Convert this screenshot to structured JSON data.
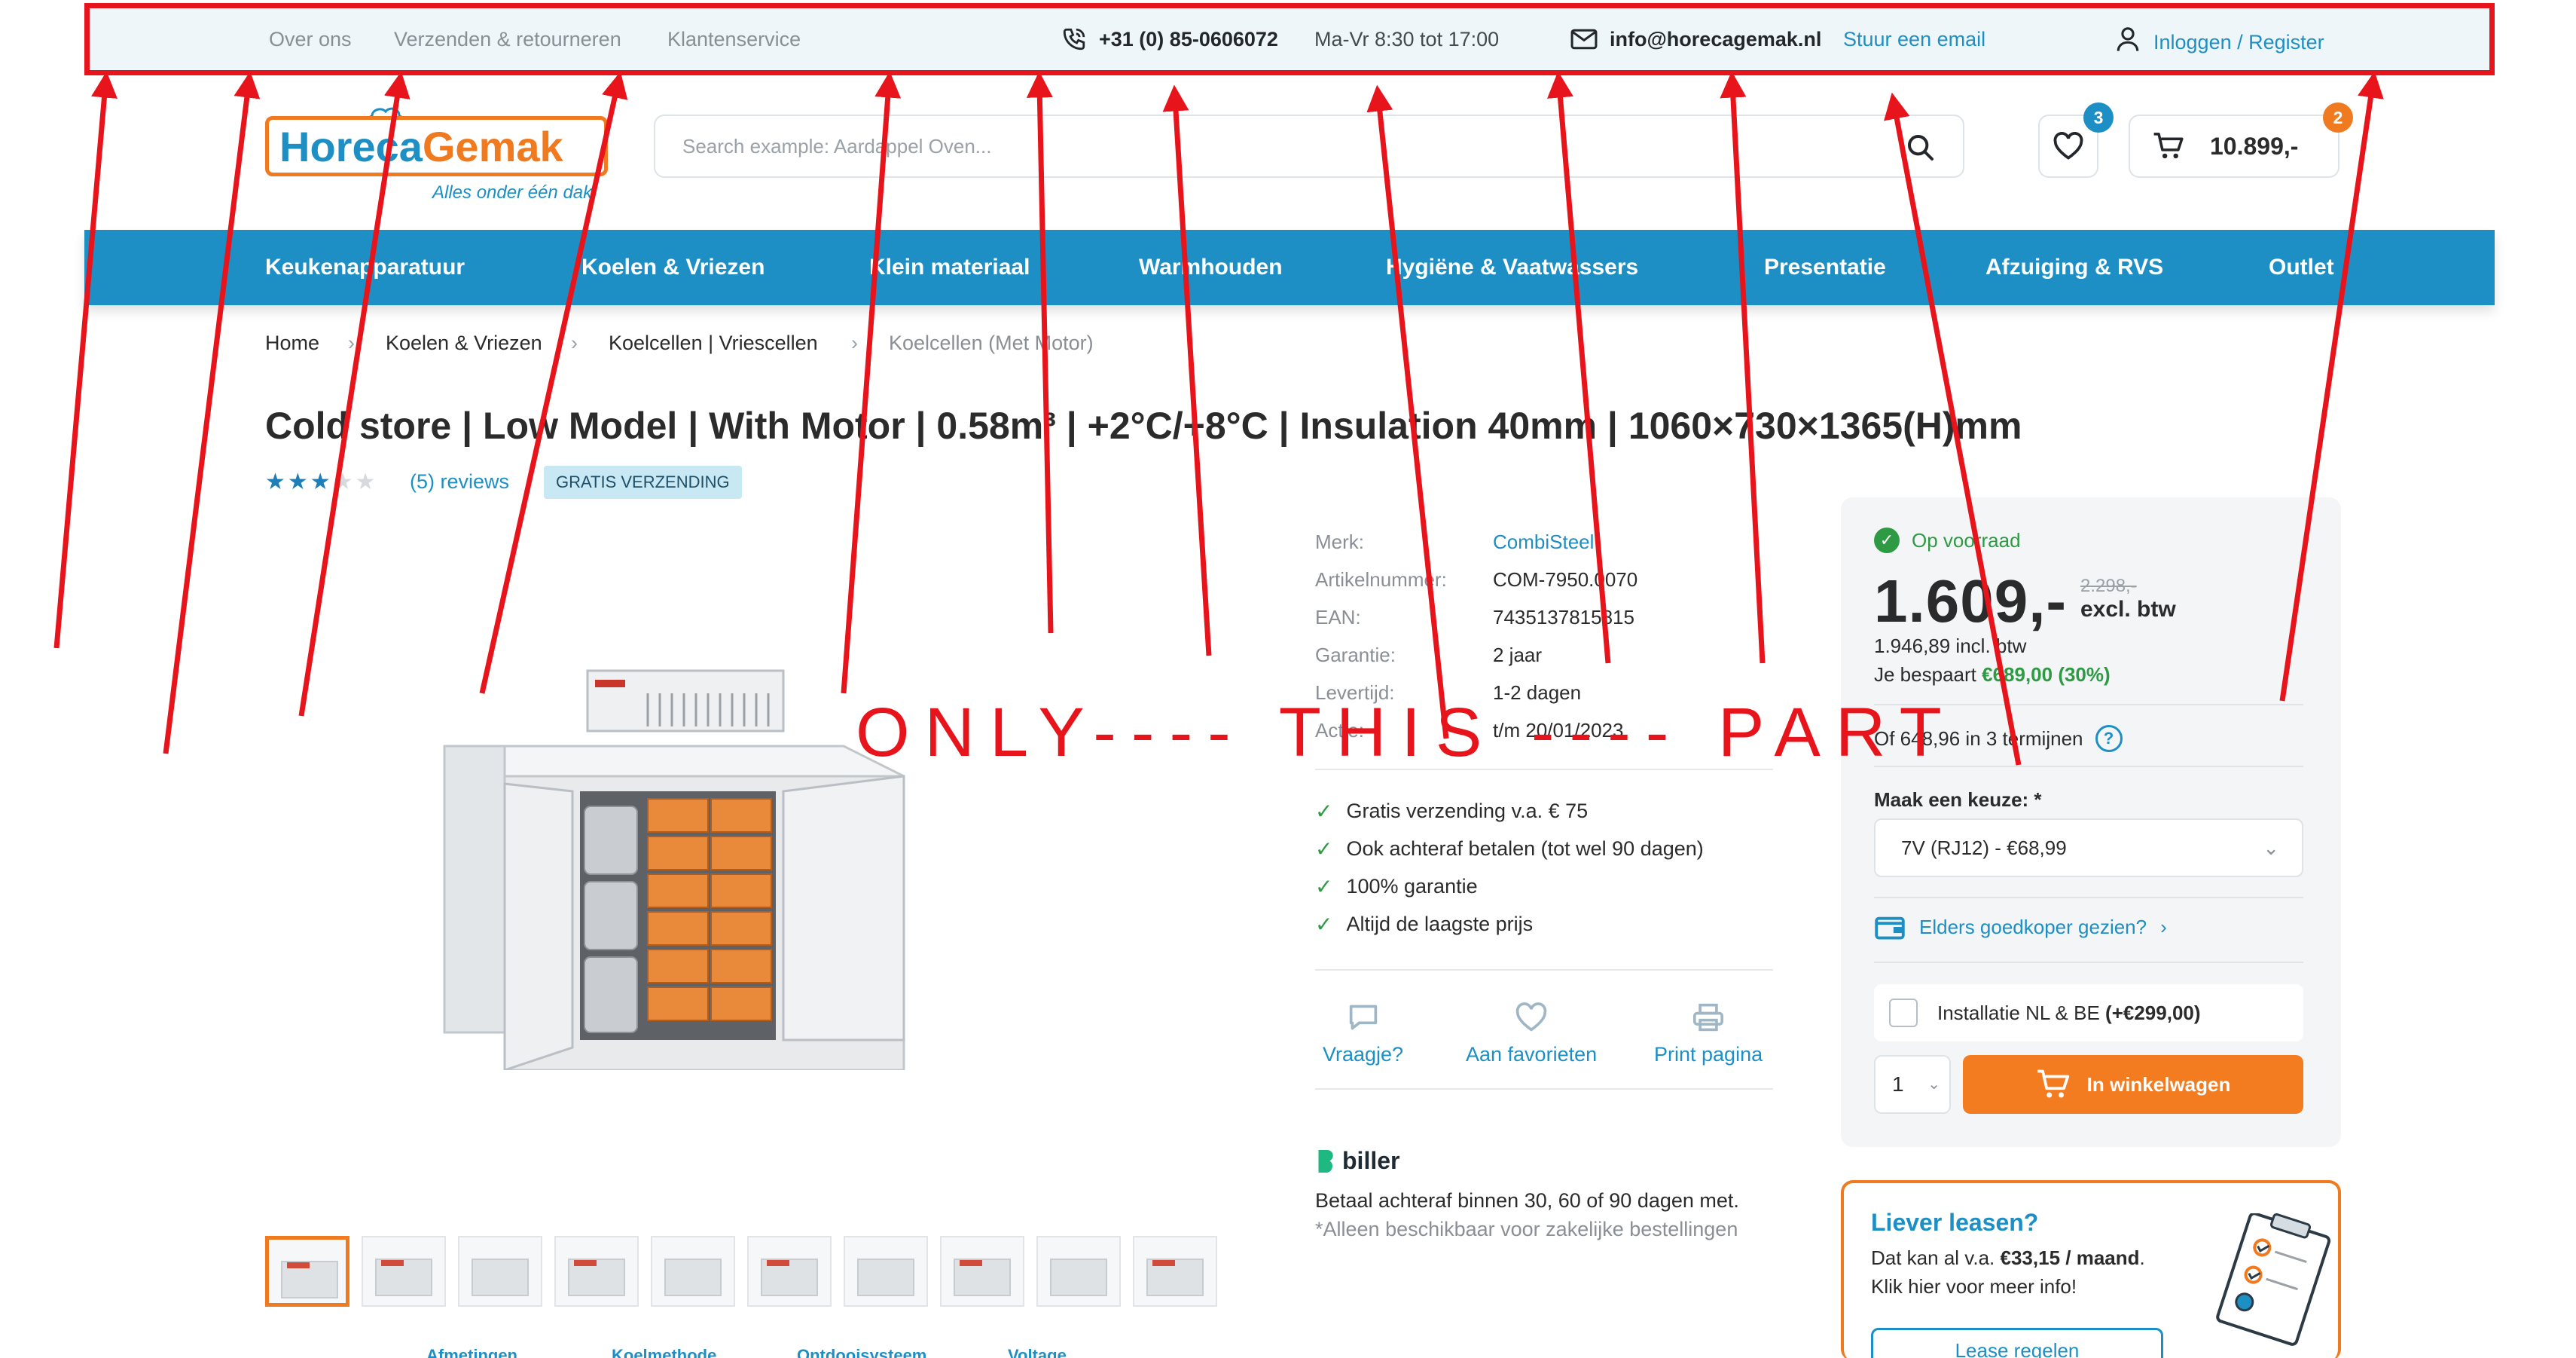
{
  "topbar": {
    "links": [
      "Over ons",
      "Verzenden & retourneren",
      "Klantenservice"
    ],
    "phone": "+31 (0) 85-0606072",
    "hours": "Ma-Vr 8:30 tot 17:00",
    "email": "info@horecagemak.nl",
    "email_link": "Stuur een email",
    "login": "Inloggen / Register"
  },
  "header": {
    "logo_part1": "Horeca",
    "logo_part2": "Gemak",
    "logo_tagline": "Alles onder één dak",
    "search_placeholder": "Search example: Aardappel Oven...",
    "wishlist_count": "3",
    "cart_count": "2",
    "cart_total": "10.899,-",
    "bubble_blue": "#1d8fc4",
    "bubble_orange": "#ef7a1f"
  },
  "nav": {
    "items": [
      "Keukenapparatuur",
      "Koelen & Vriezen",
      "Klein materiaal",
      "Warmhouden",
      "Hygiëne & Vaatwassers",
      "Presentatie",
      "Afzuiging & RVS",
      "Outlet"
    ]
  },
  "breadcrumb": {
    "items": [
      "Home",
      "Koelen & Vriezen",
      "Koelcellen | Vriescellen",
      "Koelcellen (Met Motor)"
    ],
    "sep": "›"
  },
  "product": {
    "title": "Cold store | Low Model | With Motor | 0.58m³ | +2°C/+8°C | Insulation 40mm | 1060×730×1365(H)mm",
    "rating_of_5": 3,
    "stars": "★★★★★",
    "reviews": "(5) reviews",
    "badge": "GRATIS VERZENDING",
    "thumb_labels": [
      "Afmetingen",
      "Koelmethode",
      "Ontdooisysteem",
      "Voltage"
    ]
  },
  "specs": [
    {
      "k": "Merk:",
      "v": "CombiSteel"
    },
    {
      "k": "Artikelnummer:",
      "v": "COM-7950.0070"
    },
    {
      "k": "EAN:",
      "v": "7435137815815"
    },
    {
      "k": "Garantie:",
      "v": "2 jaar"
    },
    {
      "k": "Levertijd:",
      "v": "1-2 dagen"
    },
    {
      "k": "Actie:",
      "v": "t/m 20/01/2023"
    }
  ],
  "usps": [
    "Gratis verzending v.a. € 75",
    "Ook achteraf betalen (tot wel 90 dagen)",
    "100% garantie",
    "Altijd de laagste prijs"
  ],
  "actions": [
    "Vraagje?",
    "Aan favorieten",
    "Print pagina"
  ],
  "biller": {
    "logo": "biller",
    "text": "Betaal achteraf binnen 30, 60 of 90 dagen met.",
    "note": "*Alleen beschikbaar voor zakelijke bestellingen"
  },
  "buybox": {
    "stock": "Op voorraad",
    "price": "1.609,-",
    "old_price": "2.298,-",
    "btw": "excl. btw",
    "incl": "1.946,89 incl. btw",
    "saved_prefix": "Je bespaart",
    "saved_value": "€689,00 (30%)",
    "terms": "Of 648,96 in 3 termijnen",
    "choice_label": "Maak een keuze: *",
    "choice_value": "7V (RJ12) - €68,99",
    "elders": "Elders goedkoper gezien?",
    "install_label": "Installatie NL & BE",
    "install_price": "(+€299,00)",
    "qty": "1",
    "cart_button": "In winkelwagen"
  },
  "lease": {
    "title": "Liever leasen?",
    "line1_prefix": "Dat kan al v.a.",
    "line1_value": "€33,15 / maand",
    "line2": "Klik hier voor meer info!",
    "button": "Lease regelen"
  },
  "annotation": {
    "text": "ONLY---- THIS ---- PART",
    "color": "#e8141c"
  }
}
